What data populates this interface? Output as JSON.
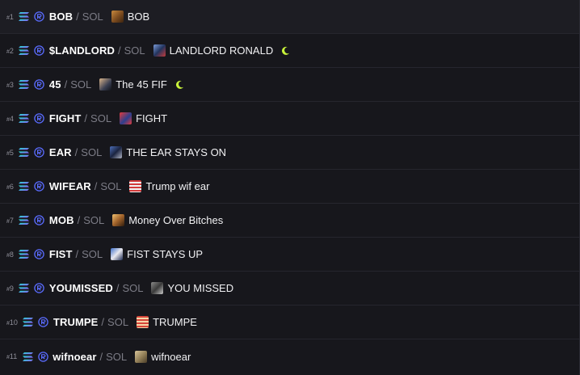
{
  "rows": [
    {
      "rank_hash": "#",
      "rank_num": "1",
      "ticker": "BOB",
      "sep": "/",
      "quote": "SOL",
      "name": "BOB",
      "thumb": "bob-thumbnail",
      "boost": false
    },
    {
      "rank_hash": "#",
      "rank_num": "2",
      "ticker": "$LANDLORD",
      "sep": "/",
      "quote": "SOL",
      "name": "LANDLORD RONALD",
      "thumb": "landlord-thumbnail",
      "boost": true
    },
    {
      "rank_hash": "#",
      "rank_num": "3",
      "ticker": "45",
      "sep": "/",
      "quote": "SOL",
      "name": "The 45 FIF",
      "thumb": "forty-five-thumbnail",
      "boost": true
    },
    {
      "rank_hash": "#",
      "rank_num": "4",
      "ticker": "FIGHT",
      "sep": "/",
      "quote": "SOL",
      "name": "FIGHT",
      "thumb": "fight-thumbnail",
      "boost": false
    },
    {
      "rank_hash": "#",
      "rank_num": "5",
      "ticker": "EAR",
      "sep": "/",
      "quote": "SOL",
      "name": "THE EAR STAYS ON",
      "thumb": "ear-thumbnail",
      "boost": false
    },
    {
      "rank_hash": "#",
      "rank_num": "6",
      "ticker": "WIFEAR",
      "sep": "/",
      "quote": "SOL",
      "name": "Trump wif ear",
      "thumb": "wifear-thumbnail",
      "boost": false
    },
    {
      "rank_hash": "#",
      "rank_num": "7",
      "ticker": "MOB",
      "sep": "/",
      "quote": "SOL",
      "name": "Money Over Bitches",
      "thumb": "mob-thumbnail",
      "boost": false
    },
    {
      "rank_hash": "#",
      "rank_num": "8",
      "ticker": "FIST",
      "sep": "/",
      "quote": "SOL",
      "name": "FIST STAYS UP",
      "thumb": "fist-thumbnail",
      "boost": false
    },
    {
      "rank_hash": "#",
      "rank_num": "9",
      "ticker": "YOUMISSED",
      "sep": "/",
      "quote": "SOL",
      "name": "YOU MISSED",
      "thumb": "youmissed-thumbnail",
      "boost": false
    },
    {
      "rank_hash": "#",
      "rank_num": "10",
      "ticker": "TRUMPE",
      "sep": "/",
      "quote": "SOL",
      "name": "TRUMPE",
      "thumb": "trumpe-thumbnail",
      "boost": false
    },
    {
      "rank_hash": "#",
      "rank_num": "11",
      "ticker": "wifnoear",
      "sep": "/",
      "quote": "SOL",
      "name": "wifnoear",
      "thumb": "wifnoear-thumbnail",
      "boost": false
    }
  ],
  "icons": {
    "chain": "solana-icon",
    "dex": "raydium-icon",
    "boost": "moon-icon"
  },
  "colors": {
    "background": "#17171c",
    "row_divider": "#26262e",
    "rank": "#8f8f99",
    "quote": "#7c7c86",
    "boost": "#c8f23a",
    "dex": "#5a6cff"
  }
}
